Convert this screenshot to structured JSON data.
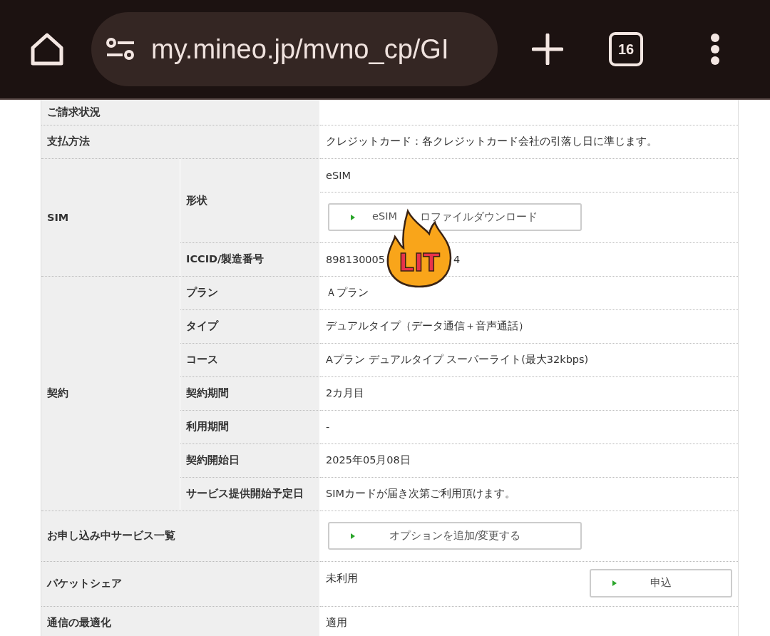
{
  "browser": {
    "url": "my.mineo.jp/mvno_cp/GI",
    "tab_count": "16"
  },
  "rows": [
    {
      "kind": "simple",
      "label": "ご請求状況",
      "value": ""
    },
    {
      "kind": "simple",
      "label": "支払方法",
      "value": "クレジットカード：各クレジットカード会社の引落し日に準じます。"
    },
    {
      "kind": "group",
      "label": "SIM",
      "items": [
        {
          "label": "形状",
          "values": [
            {
              "kind": "text",
              "text": "eSIM"
            },
            {
              "kind": "button",
              "parts": [
                "eSIM",
                "ロファイルダウンロード"
              ]
            }
          ]
        },
        {
          "label": "ICCID/製造番号",
          "values": [
            {
              "kind": "split",
              "parts": [
                "898130005",
                "4"
              ]
            }
          ]
        }
      ]
    },
    {
      "kind": "group",
      "label": "契約",
      "items": [
        {
          "label": "プラン",
          "values": [
            {
              "kind": "text",
              "text": "Ａプラン"
            }
          ]
        },
        {
          "label": "タイプ",
          "values": [
            {
              "kind": "text",
              "text": "デュアルタイプ（データ通信＋音声通話）"
            }
          ]
        },
        {
          "label": "コース",
          "values": [
            {
              "kind": "text",
              "text": "Aプラン デュアルタイプ スーパーライト(最大32kbps)"
            }
          ]
        },
        {
          "label": "契約期間",
          "values": [
            {
              "kind": "text",
              "text": "2カ月目"
            }
          ]
        },
        {
          "label": "利用期間",
          "values": [
            {
              "kind": "text",
              "text": "-"
            }
          ]
        },
        {
          "label": "契約開始日",
          "values": [
            {
              "kind": "text",
              "text": "2025年05月08日"
            }
          ]
        },
        {
          "label": "サービス提供開始予定日",
          "values": [
            {
              "kind": "text",
              "text": "SIMカードが届き次第ご利用頂けます。"
            }
          ]
        }
      ]
    },
    {
      "kind": "action",
      "label": "お申し込み中サービス一覧",
      "button": "オプションを追加/変更する"
    },
    {
      "kind": "share",
      "label": "パケットシェア",
      "value": "未利用",
      "button": "申込"
    },
    {
      "kind": "simple",
      "label": "通信の最適化",
      "value": "適用"
    }
  ],
  "sticker": {
    "text": "LIT"
  }
}
